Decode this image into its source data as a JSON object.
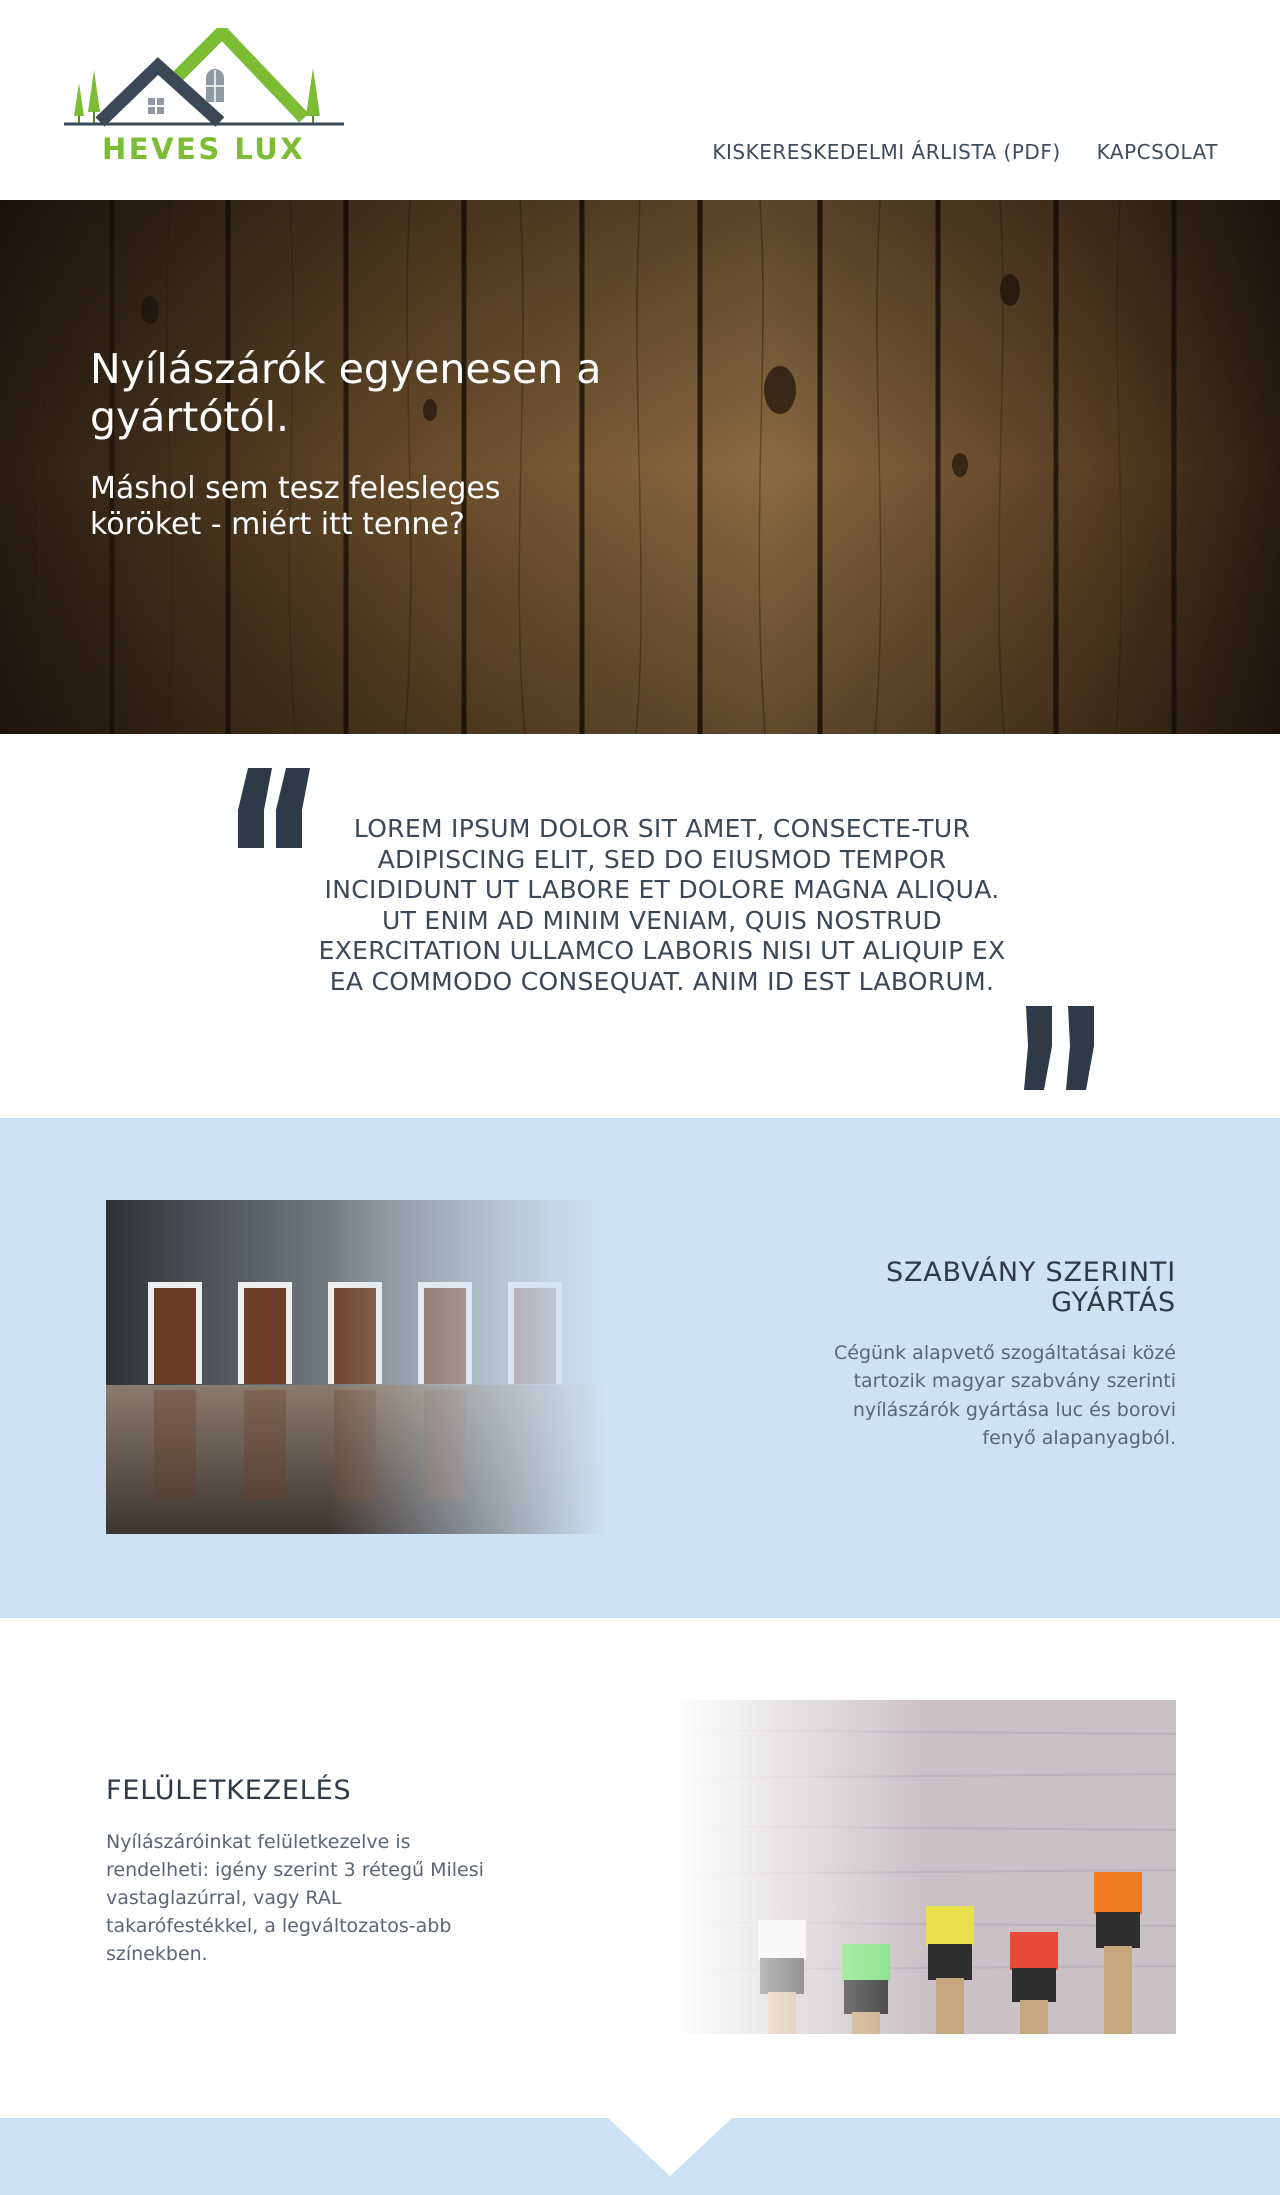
{
  "header": {
    "logo_text": "HEVES LUX",
    "nav": [
      {
        "label": "KISKERESKEDELMI ÁRLISTA (PDF)"
      },
      {
        "label": "KAPCSOLAT"
      }
    ]
  },
  "hero": {
    "title": "Nyílászárók egyenesen a gyártótól.",
    "subtitle": "Máshol sem tesz felesleges köröket - miért itt tenne?"
  },
  "quote": {
    "text": "LOREM IPSUM DOLOR SIT AMET, CONSECTE-TUR ADIPISCING ELIT, SED DO EIUSMOD TEMPOR INCIDIDUNT UT LABORE ET DOLORE MAGNA ALIQUA. UT ENIM AD MINIM VENIAM, QUIS NOSTRUD EXERCITATION ULLAMCO LABORIS NISI UT ALIQUIP EX EA COMMODO CONSEQUAT. ANIM ID EST LABORUM."
  },
  "features": [
    {
      "heading": "SZABVÁNY SZERINTI GYÁRTÁS",
      "body": "Cégünk alapvető szogáltatásai közé tartozik magyar szabvány szerinti nyílászárók gyártása luc és borovi fenyő alapanyagból."
    },
    {
      "heading": "FELÜLETKEZELÉS",
      "body": "Nyílászáróinkat felületkezelve is rendelheti: igény szerint 3 rétegű Milesi vastaglazúrral, vagy RAL takarófestékkel, a legváltozatos-abb színekben."
    }
  ],
  "colors": {
    "brand_green": "#7dbd35",
    "navy": "#2e3a48",
    "light_blue_band": "#cde2f5"
  }
}
